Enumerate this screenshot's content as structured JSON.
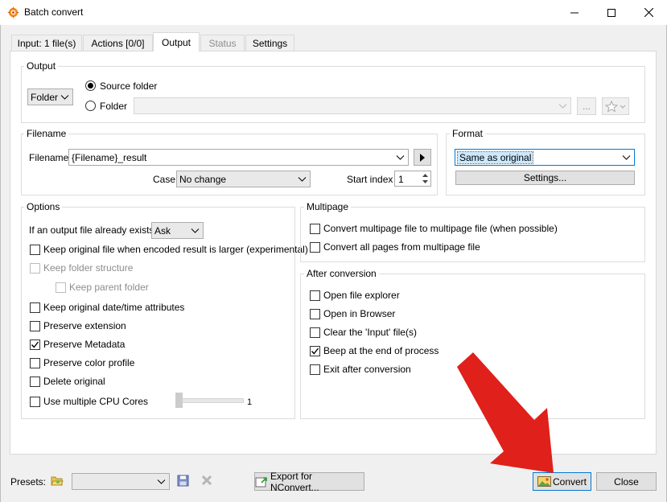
{
  "window": {
    "title": "Batch convert"
  },
  "tabs": [
    {
      "label": "Input: 1 file(s)"
    },
    {
      "label": "Actions [0/0]"
    },
    {
      "label": "Output"
    },
    {
      "label": "Status"
    },
    {
      "label": "Settings"
    }
  ],
  "output": {
    "group_label": "Output",
    "folder_combo": "Folder",
    "source_folder_label": "Source folder",
    "folder_label": "Folder",
    "folder_path": "",
    "browse_label": "...",
    "selected": "Source folder"
  },
  "filename": {
    "group_label": "Filename",
    "label": "Filename",
    "value": "{Filename}_result",
    "case_label": "Case",
    "case_value": "No change",
    "start_index_label": "Start index",
    "start_index_value": "1"
  },
  "format": {
    "group_label": "Format",
    "value": "Same as original",
    "settings_button": "Settings..."
  },
  "options": {
    "group_label": "Options",
    "exists_label": "If an output file already exists",
    "exists_value": "Ask",
    "items": [
      {
        "label": "Keep original file when encoded result is larger (experimental)",
        "checked": false,
        "enabled": true
      },
      {
        "label": "Keep folder structure",
        "checked": false,
        "enabled": false
      },
      {
        "label": "Keep parent folder",
        "checked": false,
        "enabled": false
      },
      {
        "label": "Keep original date/time attributes",
        "checked": false,
        "enabled": true
      },
      {
        "label": "Preserve extension",
        "checked": false,
        "enabled": true
      },
      {
        "label": "Preserve Metadata",
        "checked": true,
        "enabled": true
      },
      {
        "label": "Preserve color profile",
        "checked": false,
        "enabled": true
      },
      {
        "label": "Delete original",
        "checked": false,
        "enabled": true
      },
      {
        "label": "Use multiple CPU Cores",
        "checked": false,
        "enabled": true
      }
    ],
    "cpu_cores_value": "1",
    "cpu_slider_fraction": 0
  },
  "multipage": {
    "group_label": "Multipage",
    "items": [
      {
        "label": "Convert multipage file to multipage file (when possible)",
        "checked": false
      },
      {
        "label": "Convert all pages from multipage file",
        "checked": false
      }
    ]
  },
  "after": {
    "group_label": "After conversion",
    "items": [
      {
        "label": "Open file explorer",
        "checked": false
      },
      {
        "label": "Open in Browser",
        "checked": false
      },
      {
        "label": "Clear the 'Input' file(s)",
        "checked": false
      },
      {
        "label": "Beep at the end of process",
        "checked": true
      },
      {
        "label": "Exit after conversion",
        "checked": false
      }
    ]
  },
  "bottom": {
    "presets_label": "Presets:",
    "preset_value": "",
    "export_button": "Export for NConvert...",
    "convert_button": "Convert",
    "close_button": "Close"
  },
  "colors": {
    "accent": "#0078d7",
    "arrow": "#e0201b",
    "check": "#000000"
  }
}
